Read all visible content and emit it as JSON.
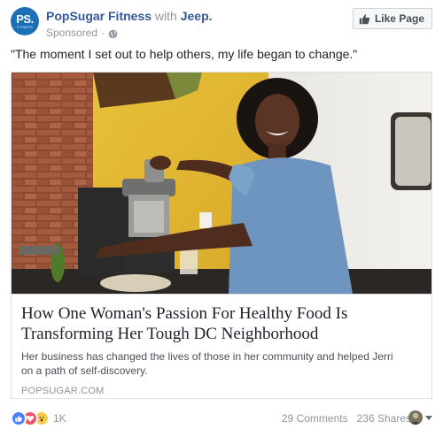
{
  "header": {
    "avatar_text": "PS.",
    "avatar_subtext": "FITNESS",
    "page_name": "PopSugar Fitness",
    "with_text": "with",
    "coauthor": "Jeep.",
    "sponsored": "Sponsored",
    "separator": "·",
    "like_page_label": "Like Page"
  },
  "post": {
    "text": "\"The moment I set out to help others, my life began to change.\""
  },
  "card": {
    "title_line1": "How One Woman's Passion For Healthy Food Is",
    "title_line2": "Transforming Her Tough DC Neighborhood",
    "desc_line1": "Her business has changed the lives of those in her community and helped Jerri",
    "desc_line2": "on a path of self-discovery.",
    "domain": "POPSUGAR.COM"
  },
  "footer": {
    "reaction_count": "1K",
    "comments": "29 Comments",
    "shares": "236 Shares"
  },
  "colors": {
    "link_blue": "#365899",
    "brand_blue": "#1a6fb8",
    "like_blue": "#4a7ffb",
    "love_red": "#f25268",
    "wow_yellow": "#f7cb4d",
    "muted_text": "#90949c"
  },
  "icons": {
    "globe": "globe-icon",
    "thumbs_up": "thumbs-up-icon",
    "heart": "heart-icon",
    "wow": "wow-face-icon",
    "caret": "caret-down-icon"
  }
}
